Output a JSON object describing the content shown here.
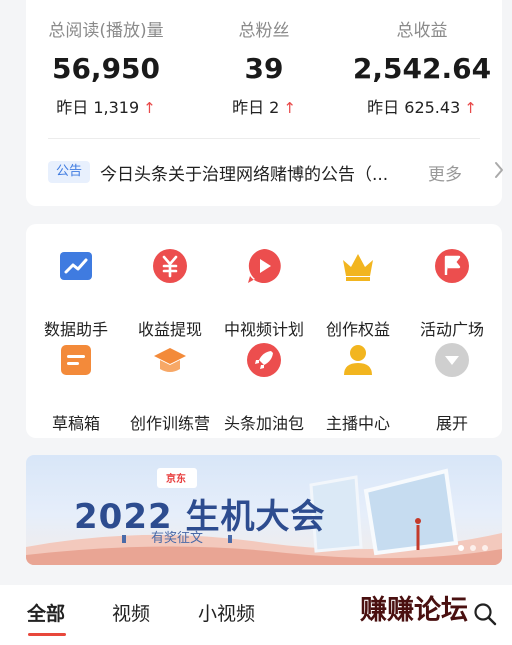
{
  "stats": [
    {
      "label": "总阅读(播放)量",
      "value": "56,950",
      "delta_prefix": "昨日",
      "delta": "1,319",
      "arrow": "↑"
    },
    {
      "label": "总粉丝",
      "value": "39",
      "delta_prefix": "昨日",
      "delta": "2",
      "arrow": "↑"
    },
    {
      "label": "总收益",
      "value": "2,542.64",
      "delta_prefix": "昨日",
      "delta": "625.43",
      "arrow": "↑"
    }
  ],
  "notice": {
    "tag": "公告",
    "text": "今日头条关于治理网络赌博的公告（...",
    "more": "更多"
  },
  "tools": [
    {
      "label": "数据助手",
      "icon": "chart-icon",
      "color": "#3f7be0"
    },
    {
      "label": "收益提现",
      "icon": "yuan-icon",
      "color": "#ec4e4e"
    },
    {
      "label": "中视频计划",
      "icon": "play-icon",
      "color": "#ec4e4e"
    },
    {
      "label": "创作权益",
      "icon": "crown-icon",
      "color": "#f2b51f"
    },
    {
      "label": "活动广场",
      "icon": "flag-icon",
      "color": "#ec4e4e"
    },
    {
      "label": "草稿箱",
      "icon": "draft-icon",
      "color": "#f38a3a"
    },
    {
      "label": "创作训练营",
      "icon": "graduation-cap-icon",
      "color": "#f38a3a"
    },
    {
      "label": "头条加油包",
      "icon": "rocket-icon",
      "color": "#ec4e4e"
    },
    {
      "label": "主播中心",
      "icon": "user-icon",
      "color": "#f2b51f"
    },
    {
      "label": "展开",
      "icon": "chevron-down-icon",
      "color": "#c9c9c9"
    }
  ],
  "banner": {
    "logo_text": "京东",
    "title": "2022 生机大会",
    "subtitle": "有奖征文"
  },
  "tabs": [
    "全部",
    "视频",
    "小视频"
  ],
  "watermark": "赚赚论坛",
  "colors": {
    "accent": "#e8473b",
    "blue": "#3f7be0"
  }
}
